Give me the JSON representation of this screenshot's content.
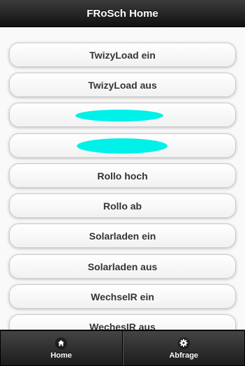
{
  "header": {
    "title": "FRoSch Home"
  },
  "buttons": [
    {
      "label": "TwizyLoad ein"
    },
    {
      "label": "TwizyLoad aus"
    },
    {
      "label": ""
    },
    {
      "label": ""
    },
    {
      "label": "Rollo hoch"
    },
    {
      "label": "Rollo ab"
    },
    {
      "label": "Solarladen ein"
    },
    {
      "label": "Solarladen aus"
    },
    {
      "label": "WechselR ein"
    },
    {
      "label": "WechesIR aus"
    }
  ],
  "navbar": {
    "tabs": [
      {
        "label": "Home",
        "icon": "home-icon"
      },
      {
        "label": "Abfrage",
        "icon": "gear-icon"
      }
    ]
  },
  "colors": {
    "redaction": "#00f0ea",
    "bar": "#1c1c1c"
  }
}
